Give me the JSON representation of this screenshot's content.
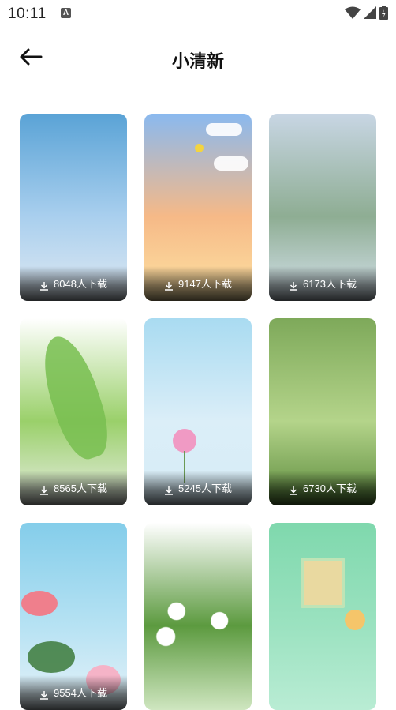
{
  "status_bar": {
    "time": "10:11",
    "notification_icon": "A"
  },
  "header": {
    "title": "小清新",
    "back_icon": "arrow-left-icon"
  },
  "download_icon": "download-icon",
  "wallpapers": [
    {
      "downloads": "8048人下载",
      "colors": [
        "#5aa3d6",
        "#a9cfee",
        "#dfe9f2"
      ]
    },
    {
      "downloads": "9147人下载",
      "colors": [
        "#8ab9ef",
        "#f6b987",
        "#fde3a3"
      ]
    },
    {
      "downloads": "6173人下载",
      "colors": [
        "#c8d6e4",
        "#8ead93",
        "#d7e3ee"
      ]
    },
    {
      "downloads": "8565人下载",
      "colors": [
        "#ffffff",
        "#9ad06a",
        "#e8ede4"
      ]
    },
    {
      "downloads": "5245人下载",
      "colors": [
        "#a9dbf1",
        "#dbeef8",
        "#d6ecf6"
      ]
    },
    {
      "downloads": "6730人下载",
      "colors": [
        "#7ea95a",
        "#b4d48a",
        "#5b8a3c"
      ]
    },
    {
      "downloads": "9554人下载",
      "colors": [
        "#84cdea",
        "#b6e2f3",
        "#e6f2f8"
      ]
    },
    {
      "downloads": "",
      "colors": [
        "#ffffff",
        "#5c9a3f",
        "#cfe6c0"
      ]
    },
    {
      "downloads": "",
      "colors": [
        "#7fd8ad",
        "#9be2c0",
        "#b9ecd4"
      ]
    }
  ]
}
